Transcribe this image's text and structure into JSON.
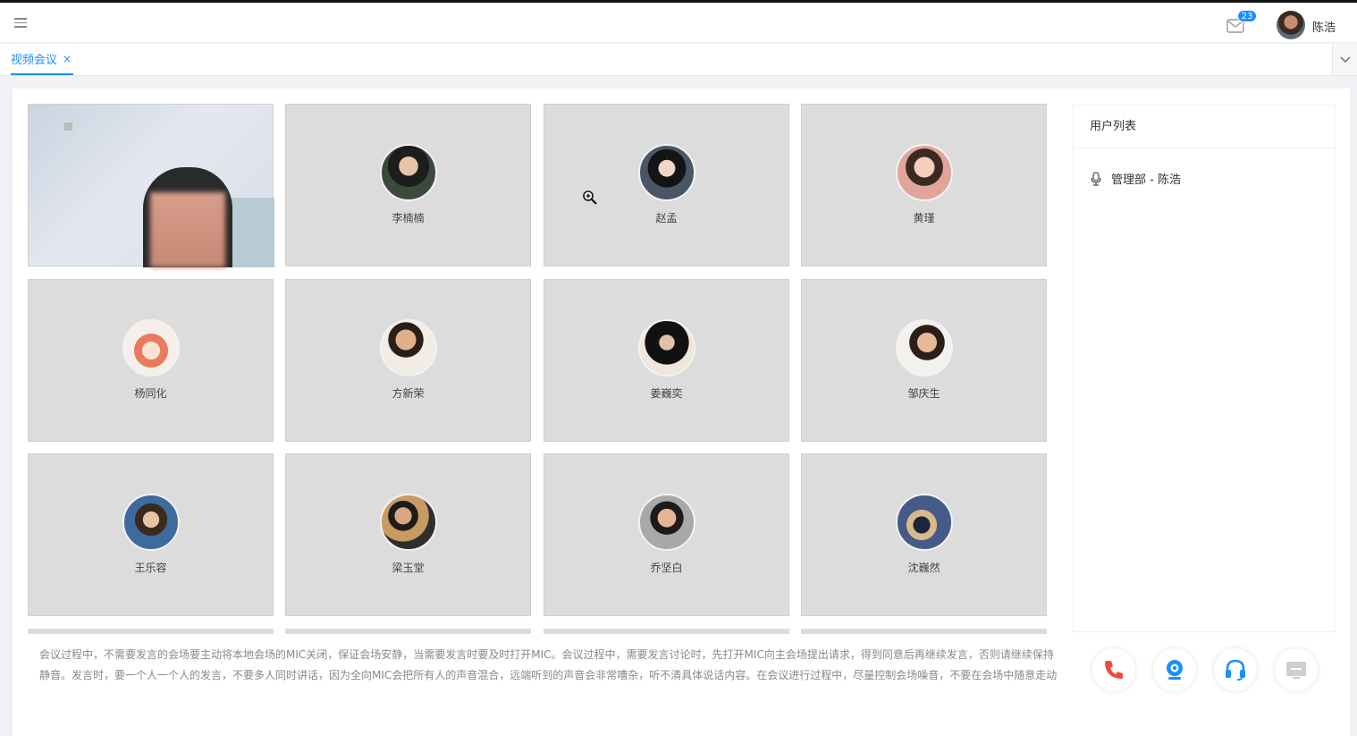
{
  "header": {
    "mail_badge": "23",
    "user_name": "陈浩"
  },
  "tabs": [
    {
      "label": "视频会议",
      "close": "×"
    }
  ],
  "participants": [
    {
      "name": "",
      "video": true
    },
    {
      "name": "李楠楠",
      "color": "#3b4a3a"
    },
    {
      "name": "赵孟",
      "color": "#4a5566"
    },
    {
      "name": "黄瑾",
      "color": "#e0a59a"
    },
    {
      "name": "杨同化",
      "color": "#e87b5e"
    },
    {
      "name": "方新荣",
      "color": "#b07a55"
    },
    {
      "name": "姜巍奕",
      "color": "#222222"
    },
    {
      "name": "邹庆生",
      "color": "#6a4e3c"
    },
    {
      "name": "王乐容",
      "color": "#3e6a9e"
    },
    {
      "name": "梁玉堂",
      "color": "#9a7a52"
    },
    {
      "name": "乔坚白",
      "color": "#5a4a3c"
    },
    {
      "name": "沈巍然",
      "color": "#445a88"
    }
  ],
  "notice": "会议过程中，不需要发言的会场要主动将本地会场的MIC关闭，保证会场安静，当需要发言时要及时打开MIC。会议过程中，需要发言讨论时，先打开MIC向主会场提出请求，得到同意后再继续发言，否则请继续保持静音。发言时，要一个人一个人的发言，不要多人同时讲话，因为全向MIC会把所有人的声音混合，远端听到的声音会非常嘈杂，听不清具体说话内容。在会议进行过程中，尽量控制会场噪音，不要在会场中随意走动",
  "user_list": {
    "title": "用户列表",
    "users": [
      "管理部 - 陈浩"
    ]
  },
  "controls": {
    "hangup_color": "#f5483b",
    "camera_color": "#1890ff",
    "headset_color": "#1890ff",
    "screen_color": "#cfcfcf"
  }
}
